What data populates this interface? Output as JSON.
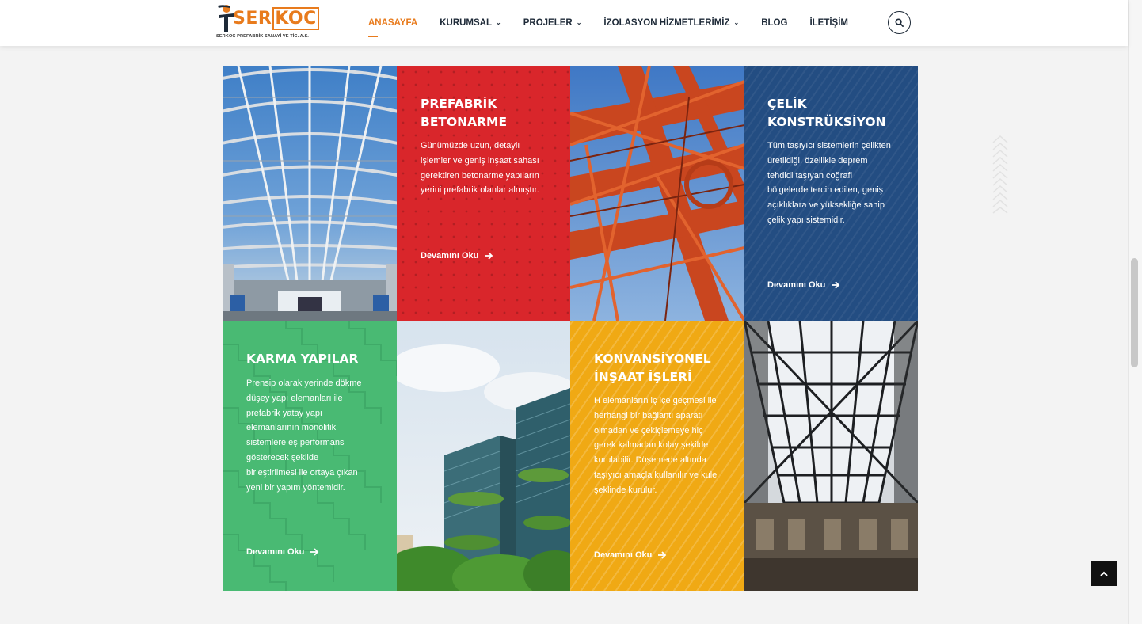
{
  "header": {
    "logo": {
      "main": "SER",
      "accent": "KOC",
      "subtitle": "SERKOÇ PREFABRİK SANAYİ VE TİC. A.Ş."
    },
    "nav": [
      {
        "label": "ANASAYFA",
        "active": true,
        "dropdown": false
      },
      {
        "label": "KURUMSAL",
        "active": false,
        "dropdown": true
      },
      {
        "label": "PROJELER",
        "active": false,
        "dropdown": true
      },
      {
        "label": "İZOLASYON HİZMETLERİMİZ",
        "active": false,
        "dropdown": true
      },
      {
        "label": "BLOG",
        "active": false,
        "dropdown": false
      },
      {
        "label": "İLETİŞİM",
        "active": false,
        "dropdown": false
      }
    ],
    "search_icon": "search-icon"
  },
  "cards": {
    "prefabrik": {
      "title_line1": "PREFABRİK",
      "title_line2": "BETONARME",
      "description": "Günümüzde uzun, detaylı işlemler ve geniş inşaat sahası gerektiren betonarme yapıların yerini prefabrik olanlar almıştır.",
      "link": "Devamını Oku",
      "color": "#d9262b"
    },
    "celik": {
      "title_line1": "ÇELİK",
      "title_line2": "KONSTRÜKSİYON",
      "description": "Tüm taşıyıcı sistemlerin çelikten üretildiği, özellikle deprem tehdidi taşıyan coğrafi bölgelerde tercih edilen, geniş açıklıklara ve yüksekliğe sahip çelik yapı sistemidir.",
      "link": "Devamını Oku",
      "color": "#234d82"
    },
    "karma": {
      "title_line1": "KARMA YAPILAR",
      "description": "Prensip olarak yerinde dökme düşey yapı elemanları ile prefabrik yatay yapı elemanlarının monolitik sistemlere eş performans gösterecek şekilde birleştirilmesi ile ortaya çıkan yeni bir yapım yöntemidir.",
      "link": "Devamını Oku",
      "color": "#49ba73"
    },
    "konvansiyonel": {
      "title_line1": "KONVANSİYONEL",
      "title_line2": "İNŞAAT İŞLERİ",
      "description": "H elemanların iç içe geçmesi ile herhangi bir bağlantı aparatı olmadan ve çekiçlemeye hiç gerek kalmadan kolay şekilde kurulabilir. Döşemede altında taşıyıcı amaçla kullanılır ve kule şeklinde kurulur.",
      "link": "Devamını Oku",
      "color": "#f0a914"
    }
  },
  "images": {
    "steel_hall": "steel-roof-hall-photo",
    "orange_truss": "orange-steel-truss-photo",
    "green_towers": "green-glass-towers-photo",
    "glass_roof": "glass-atrium-roof-photo"
  },
  "accent_color": "#e87b1d",
  "back_to_top_icon": "chevron-up-icon"
}
